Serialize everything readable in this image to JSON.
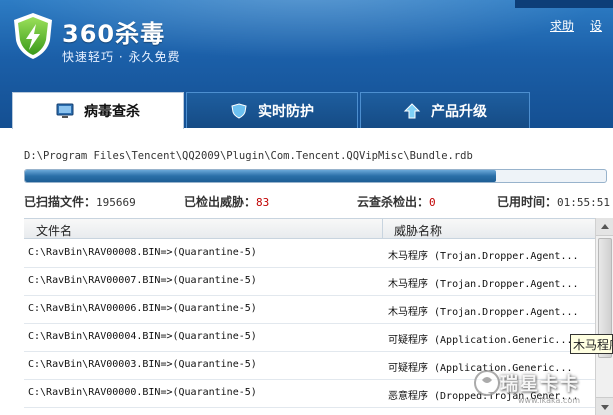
{
  "app": {
    "title": "360杀毒",
    "slogan": "快速轻巧 · 永久免费"
  },
  "top_links": {
    "help": "求助",
    "settings": "设"
  },
  "tabs": [
    {
      "label": "病毒查杀",
      "icon": "monitor-icon",
      "active": true
    },
    {
      "label": "实时防护",
      "icon": "shield-icon",
      "active": false
    },
    {
      "label": "产品升级",
      "icon": "upgrade-arrow-icon",
      "active": false
    }
  ],
  "scan": {
    "current_path": "D:\\Program Files\\Tencent\\QQ2009\\Plugin\\Com.Tencent.QQVipMisc\\Bundle.rdb",
    "progress": 0.81
  },
  "stats": {
    "scanned_label": "已扫描文件：",
    "scanned_value": "195669",
    "threats_label": "已检出威胁：",
    "threats_value": "83",
    "cloud_label": "云查杀检出：",
    "cloud_value": "0",
    "time_label": "已用时间：",
    "time_value": "01:55:51"
  },
  "table": {
    "headers": [
      "文件名",
      "威胁名称"
    ],
    "rows": [
      {
        "path": "C:\\RavBin\\RAV00008.BIN=>(Quarantine-5)",
        "threat": "木马程序 (Trojan.Dropper.Agent..."
      },
      {
        "path": "C:\\RavBin\\RAV00007.BIN=>(Quarantine-5)",
        "threat": "木马程序 (Trojan.Dropper.Agent..."
      },
      {
        "path": "C:\\RavBin\\RAV00006.BIN=>(Quarantine-5)",
        "threat": "木马程序 (Trojan.Dropper.Agent..."
      },
      {
        "path": "C:\\RavBin\\RAV00004.BIN=>(Quarantine-5)",
        "threat": "可疑程序 (Application.Generic..."
      },
      {
        "path": "C:\\RavBin\\RAV00003.BIN=>(Quarantine-5)",
        "threat": "可疑程序 (Application.Generic..."
      },
      {
        "path": "C:\\RavBin\\RAV00000.BIN=>(Quarantine-5)",
        "threat": "恶意程序 (Dropped:Trojan.Gener..."
      }
    ]
  },
  "tooltip": "木马程序",
  "watermark": {
    "text": "瑞星卡卡",
    "url": "www.ikaka.com"
  },
  "colors": {
    "header_blue": "#1b5fa8",
    "threat_red": "#c00000"
  }
}
